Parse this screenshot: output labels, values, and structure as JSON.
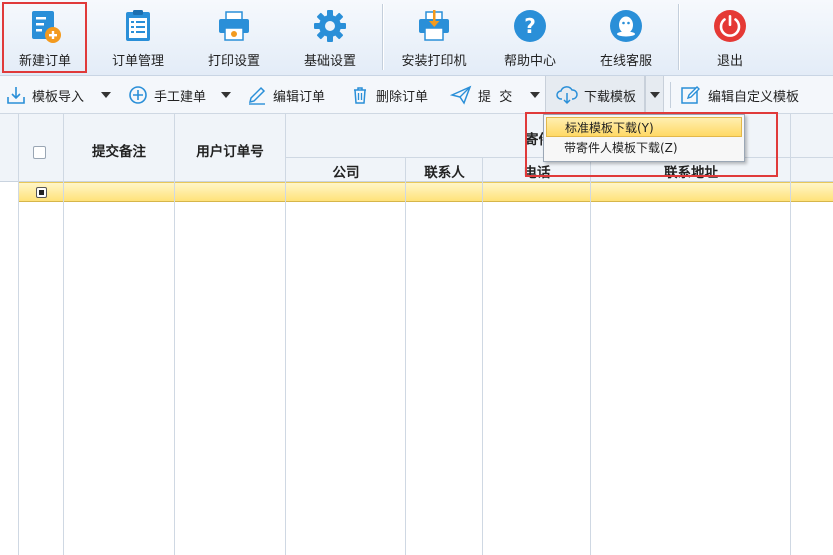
{
  "toolbar": {
    "new_order": "新建订单",
    "order_mgmt": "订单管理",
    "print_settings": "打印设置",
    "basic_settings": "基础设置",
    "install_printer": "安装打印机",
    "help_center": "帮助中心",
    "online_service": "在线客服",
    "exit": "退出"
  },
  "subtoolbar": {
    "template_import": "模板导入",
    "manual_create": "手工建单",
    "edit_order": "编辑订单",
    "delete_order": "删除订单",
    "submit": "提  交",
    "download_template": "下载模板",
    "edit_custom_template": "编辑自定义模板"
  },
  "table": {
    "col_remark": "提交备注",
    "col_user_order": "用户订单号",
    "group_sender": "寄件",
    "col_company": "公司",
    "col_contact": "联系人",
    "col_phone": "电话",
    "col_address": "联系地址"
  },
  "dropdown": {
    "items": [
      "标准模板下载(Y)",
      "带寄件人模板下载(Z)"
    ]
  },
  "colors": {
    "accent_blue": "#2a8fd8",
    "highlight_red": "#e03a3a",
    "row_yellow": "#ffe27a"
  }
}
